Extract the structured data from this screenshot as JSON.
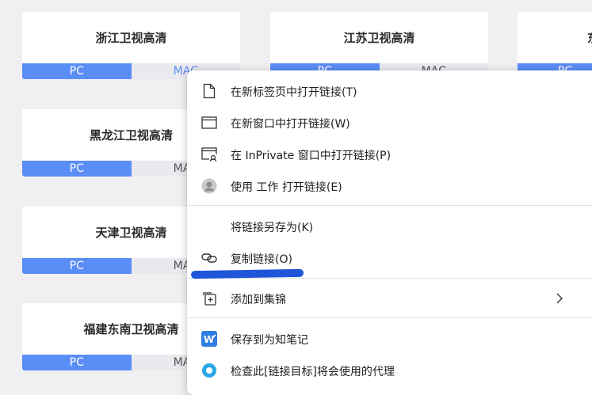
{
  "channels": [
    {
      "name": "浙江卫视高清",
      "pc": "PC",
      "mac": "MAC"
    },
    {
      "name": "江苏卫视高清",
      "pc": "PC",
      "mac": "MAC"
    },
    {
      "name": "东",
      "pc": "PC",
      "mac": ""
    },
    {
      "name": "黑龙江卫视高清",
      "pc": "PC",
      "mac": "MAC"
    },
    {
      "name": "天津卫视高清",
      "pc": "PC",
      "mac": "MAC"
    },
    {
      "name": "福建东南卫视高清",
      "pc": "PC",
      "mac": "MAC"
    }
  ],
  "context_menu": {
    "items": [
      {
        "label": "在新标签页中打开链接(T)",
        "icon": "new-tab-icon"
      },
      {
        "label": "在新窗口中打开链接(W)",
        "icon": "new-window-icon"
      },
      {
        "label": "在 InPrivate 窗口中打开链接(P)",
        "icon": "inprivate-window-icon"
      },
      {
        "label": "使用 工作 打开链接(E)",
        "icon": "profile-avatar-icon"
      },
      {
        "label": "将链接另存为(K)",
        "icon": ""
      },
      {
        "label": "复制链接(O)",
        "icon": "link-icon"
      },
      {
        "label": "添加到集锦",
        "icon": "collections-add-icon"
      },
      {
        "label": "保存到为知笔记",
        "icon": "wiz-note-icon"
      },
      {
        "label": "检查此[链接目标]将会使用的代理",
        "icon": "proxy-check-icon"
      }
    ]
  },
  "colors": {
    "accent": "#5b8df6",
    "annotation": "#1f55d8"
  }
}
